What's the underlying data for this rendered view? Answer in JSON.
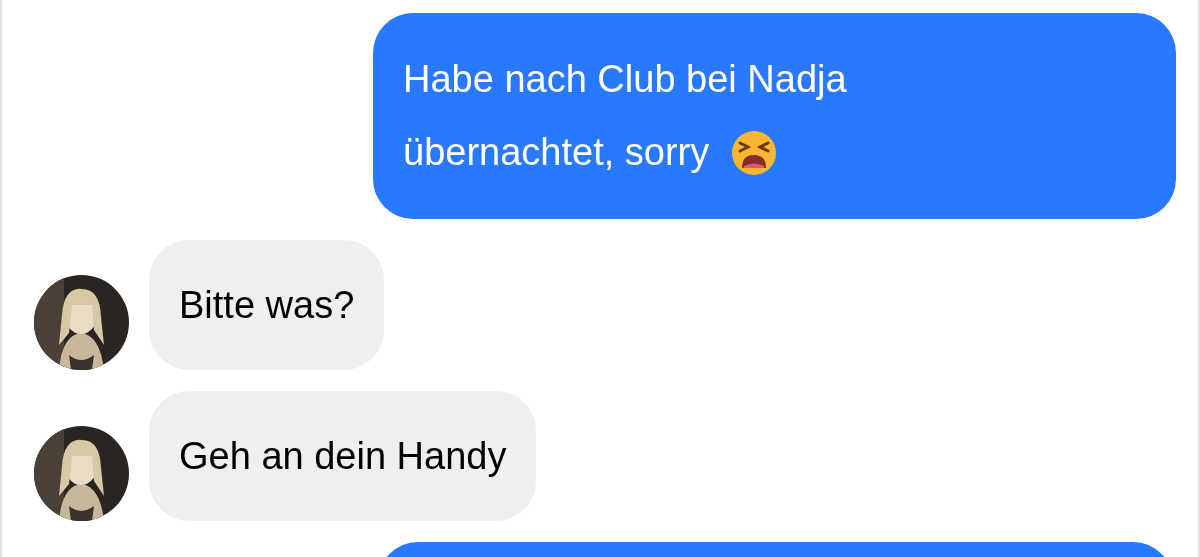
{
  "messages": [
    {
      "kind": "sent",
      "lines": [
        "Habe nach Club bei Nadja",
        "übernachtet, sorry"
      ],
      "emoji": true
    },
    {
      "kind": "received",
      "lines": [
        "Bitte was?"
      ],
      "avatar": true
    },
    {
      "kind": "received",
      "lines": [
        "Geh an dein Handy"
      ],
      "avatar": true
    },
    {
      "kind": "sent_partial"
    }
  ]
}
